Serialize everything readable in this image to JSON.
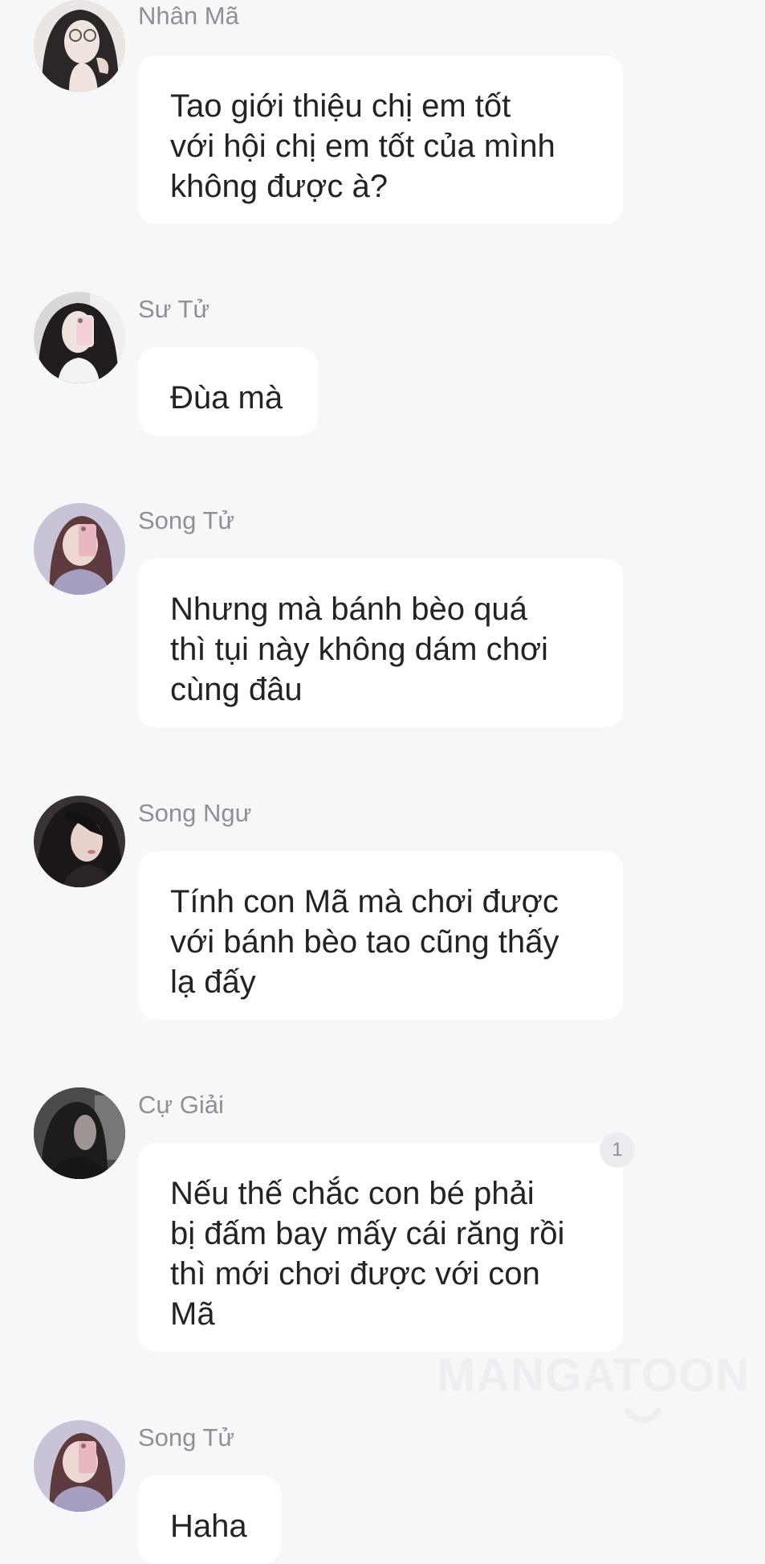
{
  "messages": [
    {
      "sender": "Nhân Mã",
      "text": "Tao giới thiệu chị em tốt\nvới hội chị em tốt của mình\nkhông được à?",
      "avatar_icon": "girl-glasses-avatar-icon"
    },
    {
      "sender": "Sư Tử",
      "text": "Đùa mà",
      "avatar_icon": "girl-phone-selfie-avatar-icon"
    },
    {
      "sender": "Song Tử",
      "text": "Nhưng mà bánh bèo quá\nthì tụi này không dám chơi\ncùng đâu",
      "avatar_icon": "girl-pink-phone-avatar-icon"
    },
    {
      "sender": "Song Ngư",
      "text": "Tính con Mã mà chơi được\nvới bánh bèo tao cũng thấy\nlạ đấy",
      "avatar_icon": "girl-dark-hair-avatar-icon"
    },
    {
      "sender": "Cự Giải",
      "text": "Nếu thế chắc con bé phải\nbị đấm bay mấy cái răng rồi\nthì mới chơi được với con\nMã",
      "avatar_icon": "dark-portrait-avatar-icon",
      "reaction_count": "1"
    },
    {
      "sender": "Song Tử",
      "text": "Haha",
      "avatar_icon": "girl-pink-phone-avatar-icon"
    }
  ],
  "watermark": {
    "text": "MANGATOON",
    "icon": "smile-logo-icon"
  },
  "colors": {
    "background": "#f6f7f9",
    "bubble": "#ffffff",
    "sender_name": "#8d9096",
    "message_text": "#222326",
    "watermark": "#eceef1"
  }
}
